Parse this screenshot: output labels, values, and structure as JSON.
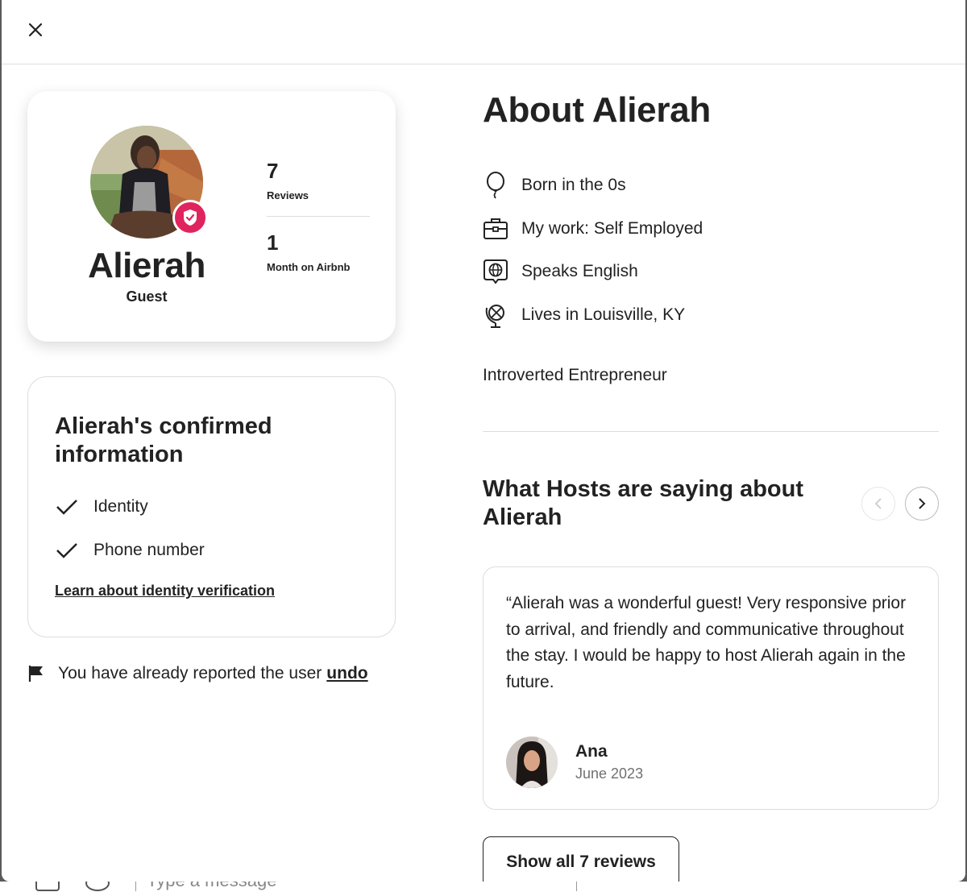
{
  "modal": {
    "close_icon": "close-icon"
  },
  "profile": {
    "name": "Alierah",
    "role": "Guest",
    "reviews_count": "7",
    "reviews_label": "Reviews",
    "months_count": "1",
    "months_label": "Month on Airbnb",
    "badge_icon": "shield-check-icon",
    "badge_color": "#E0245E"
  },
  "confirmed": {
    "title": "Alierah's confirmed information",
    "items": [
      {
        "label": "Identity",
        "icon": "check-icon"
      },
      {
        "label": "Phone number",
        "icon": "check-icon"
      }
    ],
    "learn_link": "Learn about identity verification"
  },
  "report": {
    "text": "You have already reported the user",
    "undo": "undo",
    "icon": "flag-icon"
  },
  "about": {
    "title": "About Alierah",
    "items": [
      {
        "icon": "balloon-icon",
        "label": "Born in the 0s"
      },
      {
        "icon": "briefcase-icon",
        "label": "My work: Self Employed"
      },
      {
        "icon": "globe-speech-icon",
        "label": "Speaks English"
      },
      {
        "icon": "globe-stand-icon",
        "label": "Lives in Louisville, KY"
      }
    ],
    "bio": "Introverted Entrepreneur"
  },
  "reviews": {
    "title": "What Hosts are saying about Alierah",
    "items": [
      {
        "text": "“Alierah was a wonderful guest! Very responsive prior to arrival, and friendly and communicative throughout the stay. I would be happy to host Alierah again in the future.",
        "author": "Ana",
        "date": "June 2023"
      }
    ],
    "show_all": "Show all 7 reviews"
  },
  "underlying": {
    "message_placeholder": "Type a message"
  }
}
